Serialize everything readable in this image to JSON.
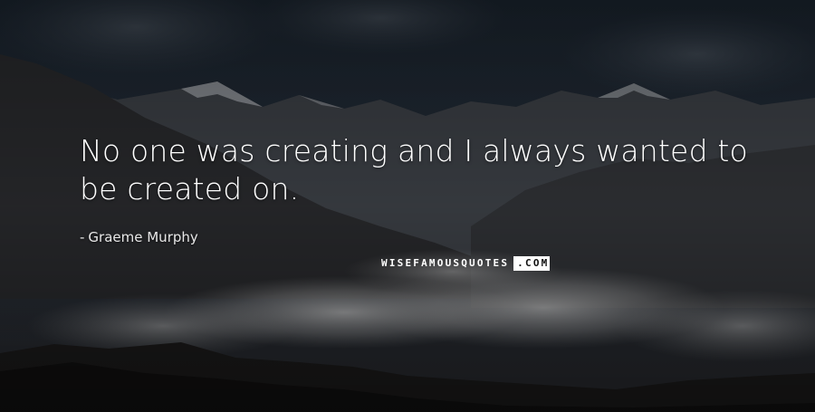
{
  "quote": {
    "text": "No one was creating and I always wanted to be created on."
  },
  "author": {
    "dash": "-",
    "name": "Graeme Murphy"
  },
  "brand": {
    "main": "WISEFAMOUSQUOTES",
    "suffix": ".COM"
  },
  "background": {
    "description_colors": {
      "sky": "#1f2833",
      "mountains": "#2a2a2c",
      "cloud": "#c9c9c9"
    }
  }
}
